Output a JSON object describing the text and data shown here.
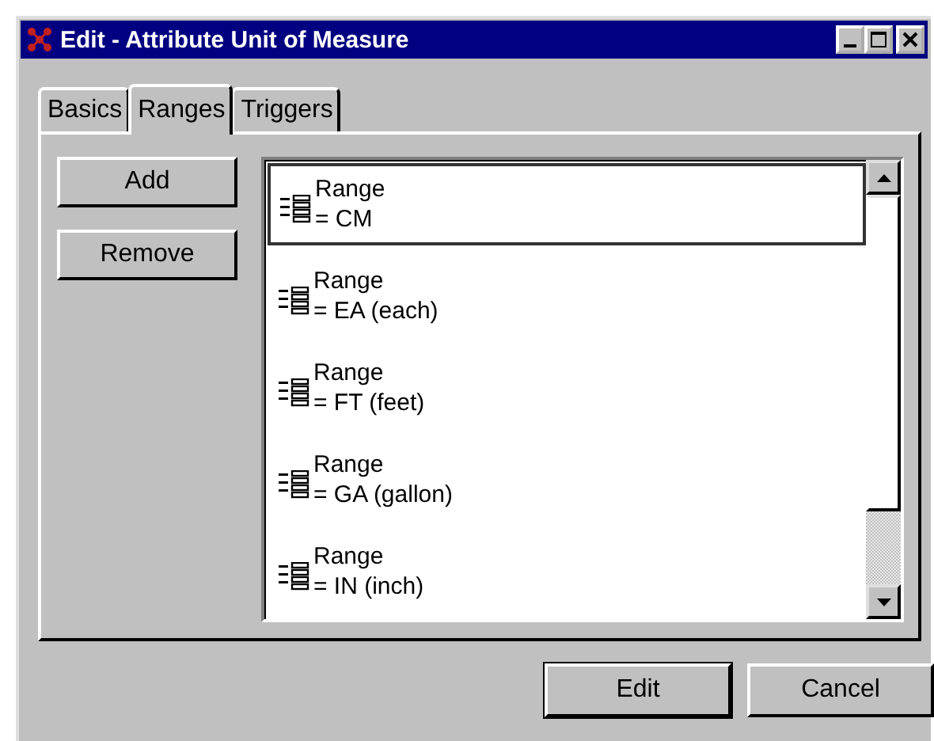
{
  "window": {
    "title": "Edit - Attribute Unit of Measure"
  },
  "tabs": [
    {
      "label": "Basics",
      "selected": false
    },
    {
      "label": "Ranges",
      "selected": true
    },
    {
      "label": "Triggers",
      "selected": false
    }
  ],
  "side_buttons": [
    "Add",
    "Remove"
  ],
  "ranges": [
    {
      "label": "Range",
      "value": "= CM",
      "selected": true
    },
    {
      "label": "Range",
      "value": "= EA (each)",
      "selected": false
    },
    {
      "label": "Range",
      "value": "= FT (feet)",
      "selected": false
    },
    {
      "label": "Range",
      "value": "= GA (gallon)",
      "selected": false
    },
    {
      "label": "Range",
      "value": "= IN (inch)",
      "selected": false
    }
  ],
  "buttons": [
    "Edit",
    "Cancel"
  ]
}
